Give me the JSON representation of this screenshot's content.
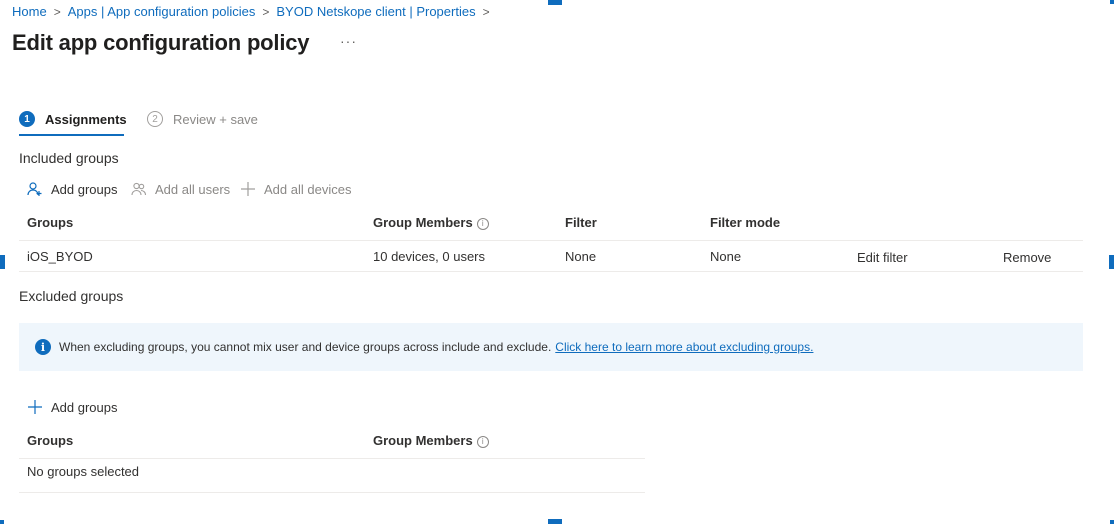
{
  "breadcrumb": [
    "Home",
    "Apps | App configuration policies",
    "BYOD Netskope client | Properties"
  ],
  "breadcrumb_separator": ">",
  "title": "Edit app configuration policy",
  "more_label": "···",
  "steps": [
    {
      "num": "1",
      "label": "Assignments"
    },
    {
      "num": "2",
      "label": "Review + save"
    }
  ],
  "included": {
    "heading": "Included groups",
    "commands": {
      "add_groups": "Add groups",
      "add_all_users": "Add all users",
      "add_all_devices": "Add all devices"
    },
    "columns": {
      "groups": "Groups",
      "members": "Group Members",
      "filter": "Filter",
      "filter_mode": "Filter mode"
    },
    "rows": [
      {
        "group": "iOS_BYOD",
        "members": "10 devices, 0 users",
        "filter": "None",
        "filter_mode": "None",
        "edit_filter": "Edit filter",
        "remove": "Remove"
      }
    ]
  },
  "excluded": {
    "heading": "Excluded groups",
    "info_message": "When excluding groups, you cannot mix user and device groups across include and exclude.",
    "info_link": "Click here to learn more about excluding groups.",
    "add_groups": "Add groups",
    "columns": {
      "groups": "Groups",
      "members": "Group Members"
    },
    "empty_text": "No groups selected"
  },
  "info_glyph": "i",
  "colors": {
    "accent": "#0f6cbd",
    "info_background": "#eff6fc",
    "text": "#323130",
    "muted": "#8a8886"
  }
}
